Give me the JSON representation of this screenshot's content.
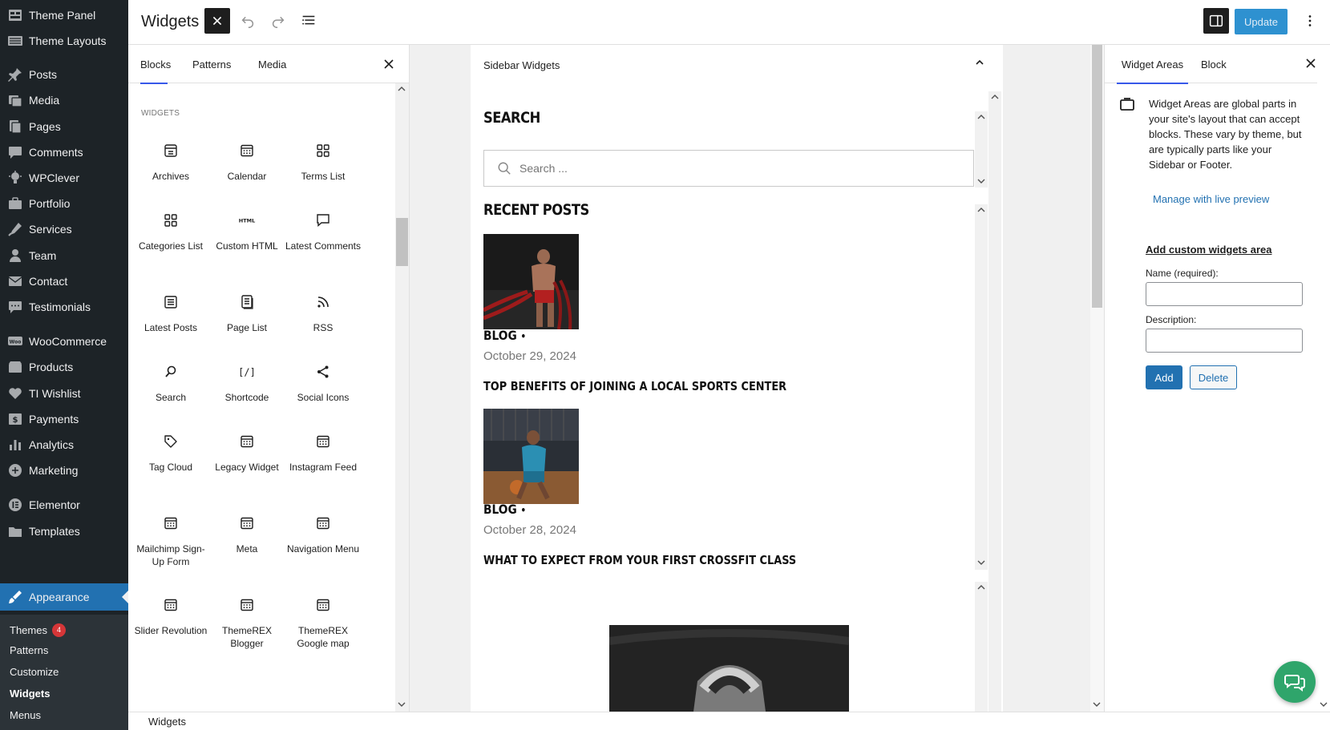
{
  "admin_menu": {
    "items": [
      {
        "label": "Theme Panel",
        "icon": "theme-panel-icon"
      },
      {
        "label": "Theme Layouts",
        "icon": "theme-layouts-icon"
      },
      {
        "label": "Posts",
        "icon": "pushpin-icon"
      },
      {
        "label": "Media",
        "icon": "media-icon"
      },
      {
        "label": "Pages",
        "icon": "pages-icon"
      },
      {
        "label": "Comments",
        "icon": "comments-icon"
      },
      {
        "label": "WPClever",
        "icon": "wpclever-icon"
      },
      {
        "label": "Portfolio",
        "icon": "portfolio-icon"
      },
      {
        "label": "Services",
        "icon": "services-icon"
      },
      {
        "label": "Team",
        "icon": "team-icon"
      },
      {
        "label": "Contact",
        "icon": "envelope-icon"
      },
      {
        "label": "Testimonials",
        "icon": "testimonials-icon"
      },
      {
        "label": "WooCommerce",
        "icon": "woocommerce-icon"
      },
      {
        "label": "Products",
        "icon": "products-icon"
      },
      {
        "label": "TI Wishlist",
        "icon": "wishlist-icon"
      },
      {
        "label": "Payments",
        "icon": "payments-icon"
      },
      {
        "label": "Analytics",
        "icon": "analytics-icon"
      },
      {
        "label": "Marketing",
        "icon": "marketing-icon"
      },
      {
        "label": "Elementor",
        "icon": "elementor-icon"
      },
      {
        "label": "Templates",
        "icon": "templates-icon"
      },
      {
        "label": "Appearance",
        "icon": "appearance-brush-icon"
      }
    ],
    "submenu": [
      {
        "label": "Themes",
        "badge": "4"
      },
      {
        "label": "Patterns"
      },
      {
        "label": "Customize"
      },
      {
        "label": "Widgets"
      },
      {
        "label": "Menus"
      }
    ]
  },
  "header": {
    "title": "Widgets",
    "update_label": "Update",
    "accent": "#3858e9",
    "update_color": "#0a7ec8"
  },
  "inserter": {
    "tabs": [
      "Blocks",
      "Patterns",
      "Media"
    ],
    "section_label": "WIDGETS",
    "blocks": [
      {
        "label": "Archives",
        "icon": "archive-icon"
      },
      {
        "label": "Calendar",
        "icon": "calendar-icon"
      },
      {
        "label": "Terms List",
        "icon": "grid-icon"
      },
      {
        "label": "Categories List",
        "icon": "grid-icon"
      },
      {
        "label": "Custom HTML",
        "icon": "html-icon"
      },
      {
        "label": "Latest Comments",
        "icon": "comment-icon"
      },
      {
        "label": "Latest Posts",
        "icon": "list-icon"
      },
      {
        "label": "Page List",
        "icon": "page-list-icon"
      },
      {
        "label": "RSS",
        "icon": "rss-icon"
      },
      {
        "label": "Search",
        "icon": "search-icon"
      },
      {
        "label": "Shortcode",
        "icon": "shortcode-icon"
      },
      {
        "label": "Social Icons",
        "icon": "share-icon"
      },
      {
        "label": "Tag Cloud",
        "icon": "tag-icon"
      },
      {
        "label": "Legacy Widget",
        "icon": "calendar-icon"
      },
      {
        "label": "Instagram Feed",
        "icon": "calendar-icon"
      },
      {
        "label": "Mailchimp Sign-Up Form",
        "icon": "calendar-icon"
      },
      {
        "label": "Meta",
        "icon": "calendar-icon"
      },
      {
        "label": "Navigation Menu",
        "icon": "calendar-icon"
      },
      {
        "label": "Slider Revolution",
        "icon": "calendar-icon"
      },
      {
        "label": "ThemeREX Blogger",
        "icon": "calendar-icon"
      },
      {
        "label": "ThemeREX Google map",
        "icon": "calendar-icon"
      }
    ]
  },
  "canvas": {
    "area_title": "Sidebar Widgets",
    "search_title": "SEARCH",
    "search_placeholder": "Search ...",
    "recent_title": "RECENT POSTS",
    "posts": [
      {
        "category": "BLOG",
        "date": "October 29, 2024",
        "title": "TOP BENEFITS OF JOINING A LOCAL SPORTS CENTER"
      },
      {
        "category": "BLOG",
        "date": "October 28, 2024",
        "title": "WHAT TO EXPECT FROM YOUR FIRST CROSSFIT CLASS"
      }
    ]
  },
  "settings": {
    "tabs": [
      "Widget Areas",
      "Block"
    ],
    "description": "Widget Areas are global parts in your site's layout that can accept blocks. These vary by theme, but are typically parts like your Sidebar or Footer.",
    "manage_link": "Manage with live preview",
    "custom_heading": "Add custom widgets area",
    "name_label": "Name (required):",
    "description_label": "Description:",
    "add_label": "Add",
    "delete_label": "Delete"
  },
  "footer": {
    "breadcrumb": "Widgets"
  }
}
